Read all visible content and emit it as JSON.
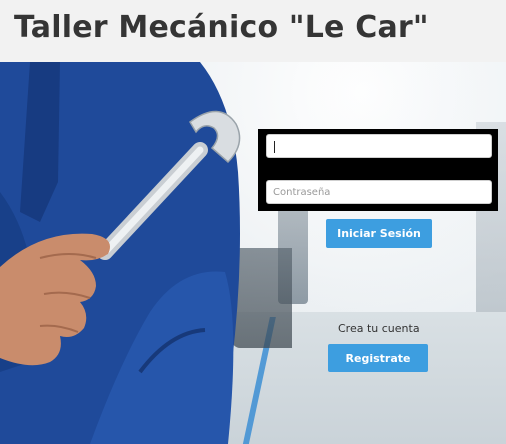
{
  "header": {
    "title": "Taller Mecánico \"Le Car\""
  },
  "login": {
    "username_value": "",
    "password_placeholder": "Contraseña",
    "login_button_label": "Iniciar Sesión"
  },
  "register": {
    "prompt": "Crea tu cuenta",
    "button_label": "Registrate"
  },
  "colors": {
    "accent": "#3d9ee0",
    "uniform": "#1f4a9a",
    "header_bg": "#f2f2f2",
    "title_text": "#353535"
  },
  "icons": [
    "wrench-icon"
  ]
}
